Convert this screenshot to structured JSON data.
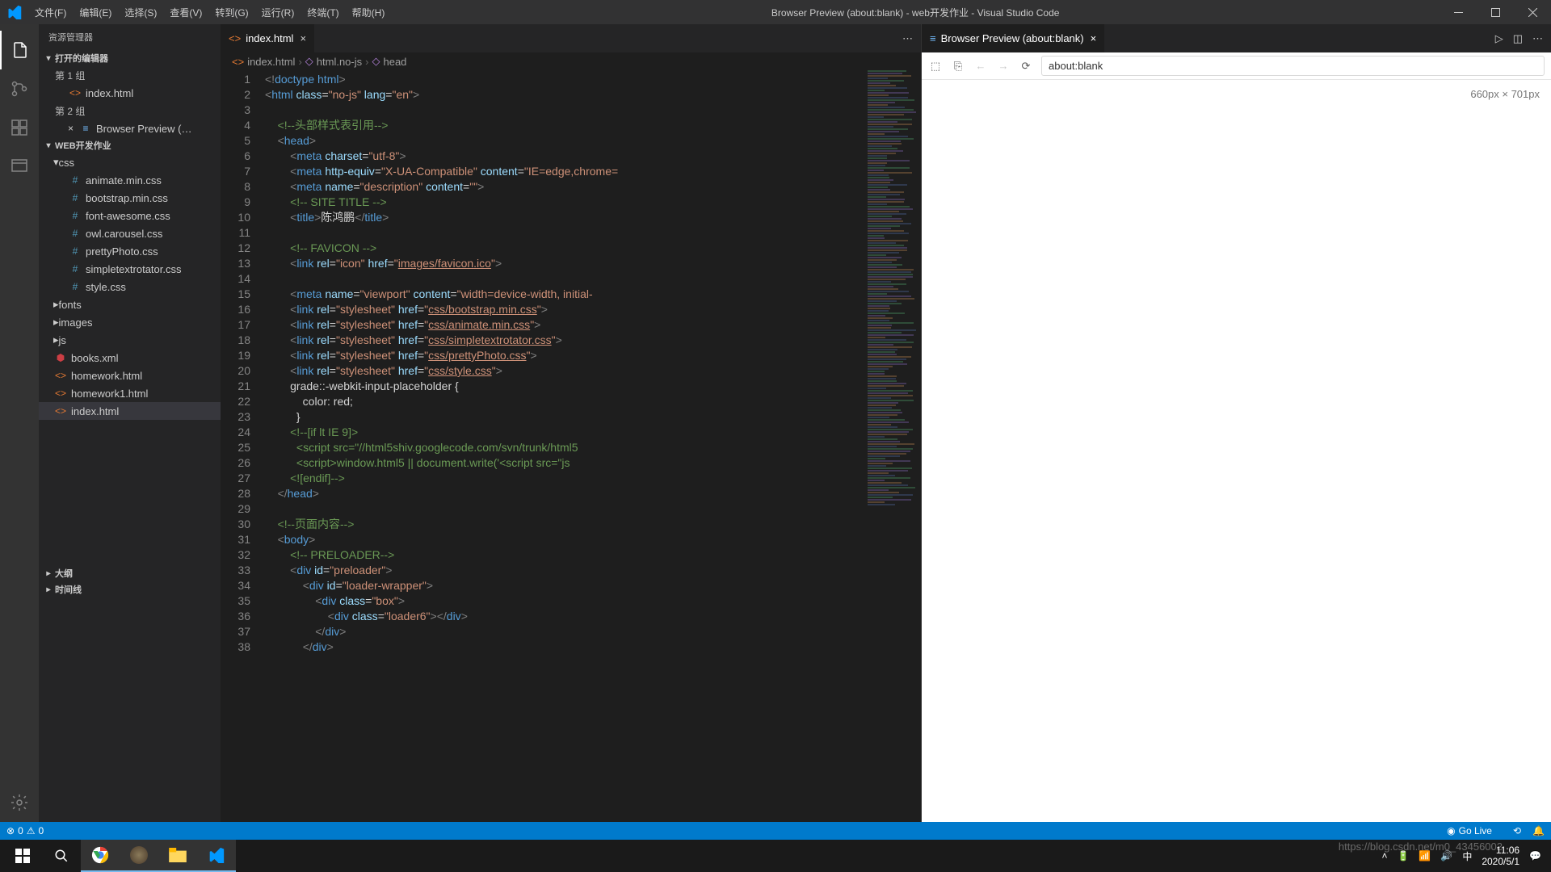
{
  "window": {
    "title": "Browser Preview (about:blank) - web开发作业 - Visual Studio Code"
  },
  "menu": [
    "文件(F)",
    "编辑(E)",
    "选择(S)",
    "查看(V)",
    "转到(G)",
    "运行(R)",
    "终端(T)",
    "帮助(H)"
  ],
  "sidebar": {
    "title": "资源管理器",
    "sections": {
      "open_editors": "打开的编辑器",
      "group1": "第 1 组",
      "group2": "第 2 组",
      "project": "WEB开发作业",
      "outline": "大纲",
      "timeline": "时间线"
    },
    "editor1": "index.html",
    "editor2": "Browser Preview (…",
    "folders": {
      "css": "css",
      "fonts": "fonts",
      "images": "images",
      "js": "js"
    },
    "css_files": [
      "animate.min.css",
      "bootstrap.min.css",
      "font-awesome.css",
      "owl.carousel.css",
      "prettyPhoto.css",
      "simpletextrotator.css",
      "style.css"
    ],
    "root_files": {
      "books": "books.xml",
      "homework": "homework.html",
      "homework1": "homework1.html",
      "index": "index.html"
    }
  },
  "editor": {
    "tab": "index.html",
    "breadcrumb": [
      "index.html",
      "html.no-js",
      "head"
    ],
    "lines": [
      "1",
      "2",
      "3",
      "4",
      "5",
      "6",
      "7",
      "8",
      "9",
      "10",
      "11",
      "12",
      "13",
      "14",
      "15",
      "16",
      "17",
      "18",
      "19",
      "20",
      "21",
      "22",
      "23",
      "24",
      "25",
      "26",
      "27",
      "28",
      "29",
      "30",
      "31",
      "32",
      "33",
      "34",
      "35",
      "36",
      "37",
      "38"
    ]
  },
  "code": {
    "l1_a": "<!",
    "l1_b": "doctype ",
    "l1_c": "html",
    "l1_d": ">",
    "l2_a": "<",
    "l2_b": "html ",
    "l2_c": "class",
    "l2_d": "=",
    "l2_e": "\"no-js\"",
    "l2_f": " lang",
    "l2_g": "=",
    "l2_h": "\"en\"",
    "l2_i": ">",
    "l4": "<!--头部样式表引用-->",
    "l5_a": "<",
    "l5_b": "head",
    "l5_c": ">",
    "l6_a": "<",
    "l6_b": "meta ",
    "l6_c": "charset",
    "l6_d": "=",
    "l6_e": "\"utf-8\"",
    "l6_f": ">",
    "l7_a": "<",
    "l7_b": "meta ",
    "l7_c": "http-equiv",
    "l7_d": "=",
    "l7_e": "\"X-UA-Compatible\"",
    "l7_f": " content",
    "l7_g": "=",
    "l7_h": "\"IE=edge,chrome=",
    "l8_a": "<",
    "l8_b": "meta ",
    "l8_c": "name",
    "l8_d": "=",
    "l8_e": "\"description\"",
    "l8_f": " content",
    "l8_g": "=",
    "l8_h": "\"\"",
    "l8_i": ">",
    "l9": "<!-- SITE TITLE -->",
    "l10_a": "<",
    "l10_b": "title",
    "l10_c": ">",
    "l10_d": "陈鸿鹏",
    "l10_e": "</",
    "l10_f": "title",
    "l10_g": ">",
    "l12": "<!-- FAVICON -->",
    "l13_a": "<",
    "l13_b": "link ",
    "l13_c": "rel",
    "l13_d": "=",
    "l13_e": "\"icon\"",
    "l13_f": " href",
    "l13_g": "=",
    "l13_h": "\"",
    "l13_i": "images/favicon.ico",
    "l13_j": "\"",
    "l13_k": ">",
    "l15_a": "<",
    "l15_b": "meta ",
    "l15_c": "name",
    "l15_d": "=",
    "l15_e": "\"viewport\"",
    "l15_f": " content",
    "l15_g": "=",
    "l15_h": "\"width=device-width, initial-",
    "l16_a": "<",
    "l16_b": "link ",
    "l16_c": "rel",
    "l16_d": "=",
    "l16_e": "\"stylesheet\"",
    "l16_f": " href",
    "l16_g": "=",
    "l16_h": "\"",
    "l16_i": "css/bootstrap.min.css",
    "l16_j": "\"",
    "l16_k": ">",
    "l17_i": "css/animate.min.css",
    "l18_i": "css/simpletextrotator.css",
    "l19_i": "css/prettyPhoto.css",
    "l20_i": "css/style.css",
    "l21": "grade::-webkit-input-placeholder {",
    "l22": "    color: red;",
    "l23": "  }",
    "l24": "<!--[if lt IE 9]>",
    "l25": "  <script src=\"//html5shiv.googlecode.com/svn/trunk/html5",
    "l26": "  <script>window.html5 || document.write('<script src=\"js",
    "l27": "<![endif]-->",
    "l28_a": "</",
    "l28_b": "head",
    "l28_c": ">",
    "l30": "<!--页面内容-->",
    "l31_a": "<",
    "l31_b": "body",
    "l31_c": ">",
    "l32": "<!-- PRELOADER-->",
    "l33_a": "<",
    "l33_b": "div ",
    "l33_c": "id",
    "l33_d": "=",
    "l33_e": "\"preloader\"",
    "l33_f": ">",
    "l34_a": "<",
    "l34_b": "div ",
    "l34_c": "id",
    "l34_d": "=",
    "l34_e": "\"loader-wrapper\"",
    "l34_f": ">",
    "l35_a": "<",
    "l35_b": "div ",
    "l35_c": "class",
    "l35_d": "=",
    "l35_e": "\"box\"",
    "l35_f": ">",
    "l36_a": "<",
    "l36_b": "div ",
    "l36_c": "class",
    "l36_d": "=",
    "l36_e": "\"loader6\"",
    "l36_f": "></",
    "l36_g": "div",
    "l36_h": ">",
    "l37_a": "</",
    "l37_b": "div",
    "l37_c": ">",
    "l38_a": "</",
    "l38_b": "div",
    "l38_c": ">"
  },
  "preview": {
    "tab": "Browser Preview (about:blank)",
    "url": "about:blank",
    "dims": "660px × 701px"
  },
  "statusbar": {
    "errors": "0",
    "warnings": "0",
    "golive": "Go Live"
  },
  "taskbar": {
    "time": "11:06",
    "date": "2020/5/1",
    "ime": "中",
    "watermark": "https://blog.csdn.net/m0_43456002"
  }
}
